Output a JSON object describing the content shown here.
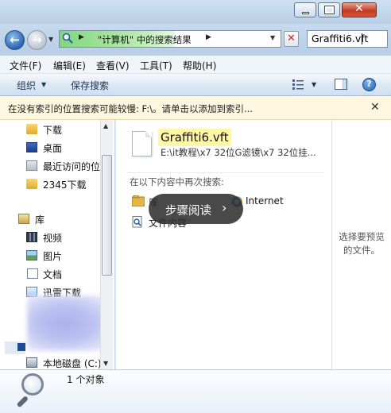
{
  "window": {
    "close_glyph": "✕"
  },
  "nav": {
    "back_glyph": "←",
    "forward_glyph": "→",
    "history_drop_glyph": "▼",
    "address": {
      "icon": "search-folder-icon",
      "separator": "▶",
      "text": "\"计算机\" 中的搜索结果",
      "dropdown_glyph": "▼"
    },
    "stop_glyph": "✕",
    "search_value": "Graffiti6.vft"
  },
  "menubar": {
    "items": [
      "文件(F)",
      "编辑(E)",
      "查看(V)",
      "工具(T)",
      "帮助(H)"
    ]
  },
  "toolbar": {
    "organize_label": "组织",
    "organize_drop_glyph": "▼",
    "save_search_label": "保存搜索",
    "view_drop_glyph": "▼",
    "help_glyph": "?"
  },
  "infobar": {
    "text": "在没有索引的位置搜索可能较慢: F:\\。请单击以添加到索引...",
    "close_glyph": "✕"
  },
  "navpane": {
    "items": [
      {
        "label": "下载",
        "icon": "download-folder-icon"
      },
      {
        "label": "桌面",
        "icon": "desktop-icon"
      },
      {
        "label": "最近访问的位",
        "icon": "recent-places-icon"
      },
      {
        "label": "2345下载",
        "icon": "folder-icon"
      },
      {
        "label": "库",
        "icon": "library-icon"
      },
      {
        "label": "视频",
        "icon": "video-library-icon"
      },
      {
        "label": "图片",
        "icon": "pictures-library-icon"
      },
      {
        "label": "文档",
        "icon": "documents-library-icon"
      },
      {
        "label": "迅雷下载",
        "icon": "thunder-download-icon"
      },
      {
        "label": "本地磁盘 (C:)",
        "icon": "local-disk-icon"
      }
    ],
    "scroll_up_glyph": "▲",
    "scroll_down_glyph": "▼"
  },
  "results": {
    "file": {
      "name": "Graffiti6.vft",
      "path": "E:\\it教程\\x7 32位G滤镜\\x7  32位挂..."
    },
    "search_again": {
      "title": "在以下内容中再次搜索:",
      "items": [
        "库",
        "文件内容",
        "Internet"
      ]
    }
  },
  "overlay": {
    "label": "步骤阅读",
    "arrow": "›"
  },
  "preview": {
    "text": "选择要预览的文件。"
  },
  "details": {
    "count": "1 个对象"
  }
}
